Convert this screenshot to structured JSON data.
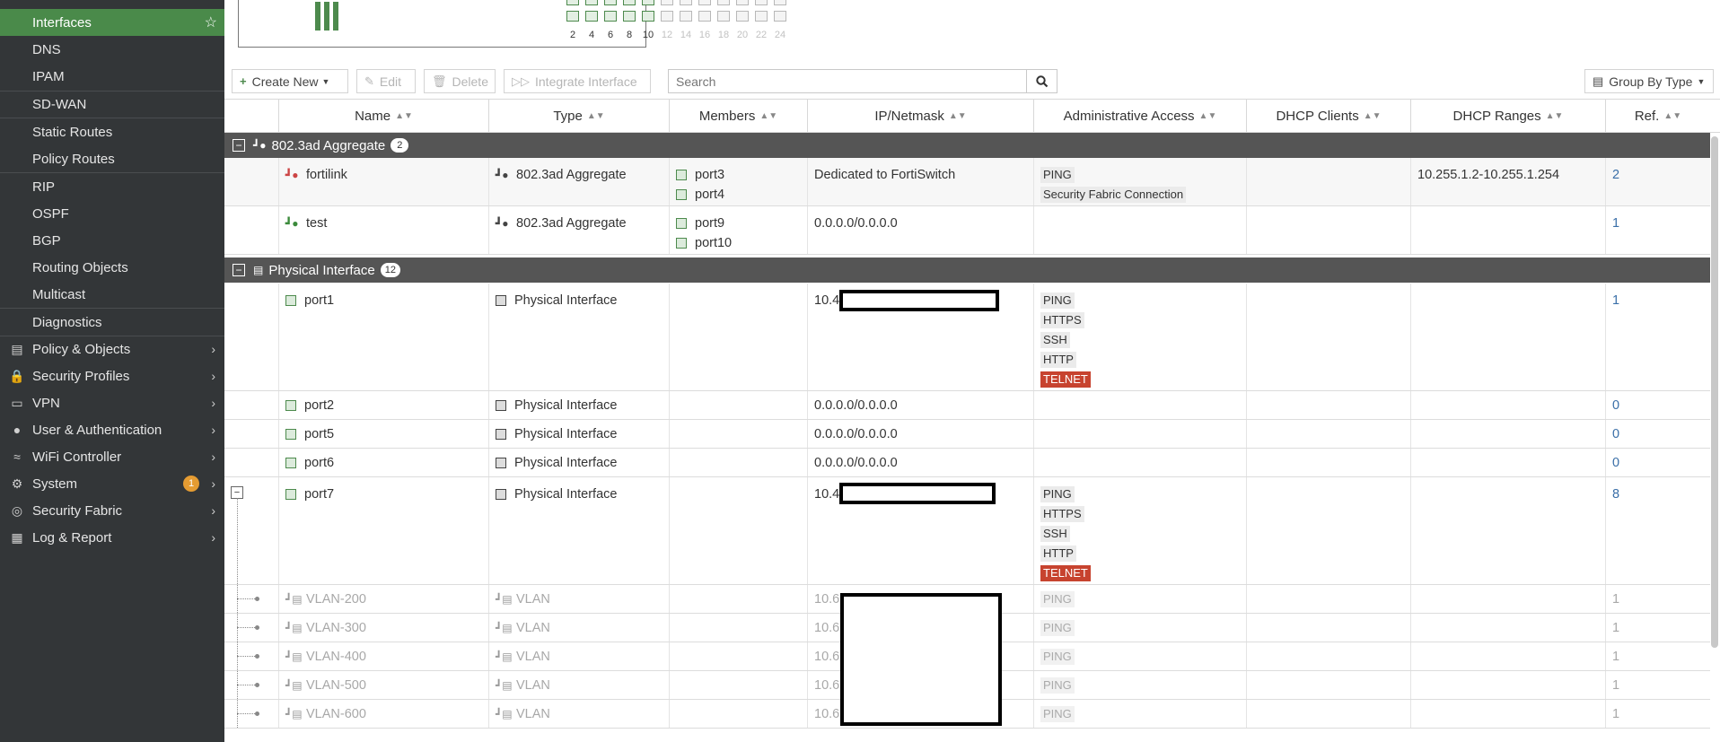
{
  "sidebar": {
    "items": [
      {
        "label": "Interfaces",
        "active": true
      },
      {
        "label": "DNS"
      },
      {
        "label": "IPAM"
      },
      {
        "label": "SD-WAN"
      },
      {
        "label": "Static Routes"
      },
      {
        "label": "Policy Routes"
      },
      {
        "label": "RIP"
      },
      {
        "label": "OSPF"
      },
      {
        "label": "BGP"
      },
      {
        "label": "Routing Objects"
      },
      {
        "label": "Multicast"
      },
      {
        "label": "Diagnostics"
      }
    ],
    "top_items": [
      {
        "label": "Policy & Objects",
        "icon": "file-icon"
      },
      {
        "label": "Security Profiles",
        "icon": "lock-icon"
      },
      {
        "label": "VPN",
        "icon": "laptop-icon"
      },
      {
        "label": "User & Authentication",
        "icon": "user-icon"
      },
      {
        "label": "WiFi Controller",
        "icon": "wifi-icon"
      },
      {
        "label": "System",
        "icon": "gear-icon",
        "badge": "1"
      },
      {
        "label": "Security Fabric",
        "icon": "fabric-icon"
      },
      {
        "label": "Log & Report",
        "icon": "chart-icon"
      }
    ]
  },
  "faceplate": {
    "port_numbers": [
      "2",
      "4",
      "6",
      "8",
      "10",
      "12",
      "14",
      "16",
      "18",
      "20",
      "22",
      "24"
    ]
  },
  "toolbar": {
    "create_new": "Create New",
    "edit": "Edit",
    "delete": "Delete",
    "integrate": "Integrate Interface",
    "search_placeholder": "Search",
    "group_by": "Group By Type"
  },
  "columns": [
    "Name",
    "Type",
    "Members",
    "IP/Netmask",
    "Administrative Access",
    "DHCP Clients",
    "DHCP Ranges",
    "Ref."
  ],
  "groups": [
    {
      "label": "802.3ad Aggregate",
      "count": "2"
    },
    {
      "label": "Physical Interface",
      "count": "12"
    }
  ],
  "rows": {
    "fortilink": {
      "name": "fortilink",
      "type": "802.3ad Aggregate",
      "members": [
        "port3",
        "port4"
      ],
      "ip": "Dedicated to FortiSwitch",
      "access": [
        "PING",
        "Security Fabric Connection"
      ],
      "dhcp_ranges": "10.255.1.2-10.255.1.254",
      "ref": "2"
    },
    "test": {
      "name": "test",
      "type": "802.3ad Aggregate",
      "members": [
        "port9",
        "port10"
      ],
      "ip": "0.0.0.0/0.0.0.0",
      "ref": "1"
    },
    "port1": {
      "name": "port1",
      "type": "Physical Interface",
      "ip": "10.4",
      "access": [
        "PING",
        "HTTPS",
        "SSH",
        "HTTP",
        "TELNET"
      ],
      "ref": "1"
    },
    "port2": {
      "name": "port2",
      "type": "Physical Interface",
      "ip": "0.0.0.0/0.0.0.0",
      "ref": "0"
    },
    "port5": {
      "name": "port5",
      "type": "Physical Interface",
      "ip": "0.0.0.0/0.0.0.0",
      "ref": "0"
    },
    "port6": {
      "name": "port6",
      "type": "Physical Interface",
      "ip": "0.0.0.0/0.0.0.0",
      "ref": "0"
    },
    "port7": {
      "name": "port7",
      "type": "Physical Interface",
      "ip": "10.4",
      "access": [
        "PING",
        "HTTPS",
        "SSH",
        "HTTP",
        "TELNET"
      ],
      "ref": "8"
    },
    "vlans": [
      {
        "name": "VLAN-200",
        "type": "VLAN",
        "ip": "10.6",
        "access": "PING",
        "ref": "1"
      },
      {
        "name": "VLAN-300",
        "type": "VLAN",
        "ip": "10.6",
        "access": "PING",
        "ref": "1"
      },
      {
        "name": "VLAN-400",
        "type": "VLAN",
        "ip": "10.6",
        "access": "PING",
        "ref": "1"
      },
      {
        "name": "VLAN-500",
        "type": "VLAN",
        "ip": "10.6",
        "access": "PING",
        "ref": "1"
      },
      {
        "name": "VLAN-600",
        "type": "VLAN",
        "ip": "10.6",
        "access": "PING",
        "ref": "1"
      }
    ]
  }
}
